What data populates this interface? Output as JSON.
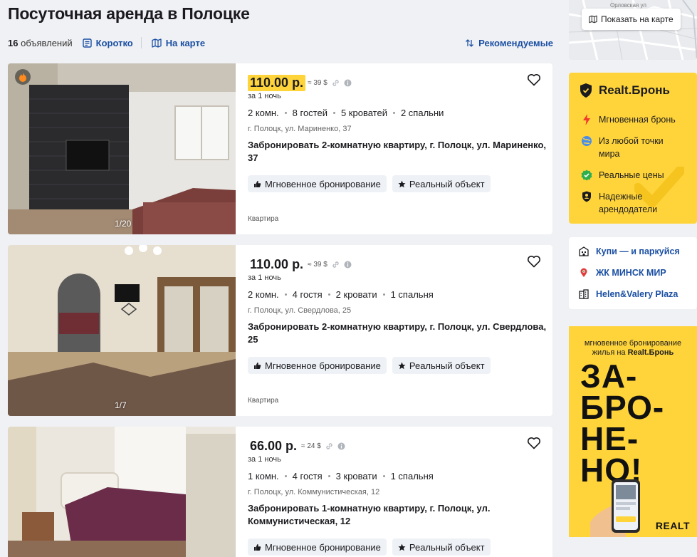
{
  "page": {
    "title": "Посуточная аренда в Полоцке"
  },
  "toolbar": {
    "count_number": "16",
    "count_label": "объявлений",
    "short_label": "Коротко",
    "map_label": "На карте",
    "sort_label": "Рекомендуемые"
  },
  "listings": [
    {
      "price": "110.00 р.",
      "usd": "≈ 39 $",
      "per": "за 1 ночь",
      "specs": [
        "2 комн.",
        "8 гостей",
        "5 кроватей",
        "2 спальни"
      ],
      "address": "г. Полоцк, ул. Мариненко, 37",
      "description": "Забронировать 2-комнатную квартиру, г. Полоцк, ул. Мариненко, 37",
      "badges": [
        "Мгновенное бронирование",
        "Реальный объект"
      ],
      "kind": "Квартира",
      "photo_counter": "1/20",
      "highlighted": true
    },
    {
      "price": "110.00 р.",
      "usd": "≈ 39 $",
      "per": "за 1 ночь",
      "specs": [
        "2 комн.",
        "4 гостя",
        "2 кровати",
        "1 спальня"
      ],
      "address": "г. Полоцк, ул. Свердлова, 25",
      "description": "Забронировать 2-комнатную квартиру, г. Полоцк, ул. Свердлова, 25",
      "badges": [
        "Мгновенное бронирование",
        "Реальный объект"
      ],
      "kind": "Квартира",
      "photo_counter": "1/7",
      "highlighted": false
    },
    {
      "price": "66.00 р.",
      "usd": "≈ 24 $",
      "per": "за 1 ночь",
      "specs": [
        "1 комн.",
        "4 гостя",
        "3 кровати",
        "1 спальня"
      ],
      "address": "г. Полоцк, ул. Коммунистическая, 12",
      "description": "Забронировать 1-комнатную квартиру, г. Полоцк, ул. Коммунистическая, 12",
      "badges": [
        "Мгновенное бронирование",
        "Реальный объект"
      ],
      "kind": "",
      "photo_counter": "",
      "highlighted": false
    }
  ],
  "sidebar": {
    "map_button": "Показать на карте",
    "map_labels": [
      "Орловская ул"
    ],
    "realt_title": "Realt.Бронь",
    "realt_items": [
      {
        "icon": "lightning-icon",
        "text": "Мгновенная бронь"
      },
      {
        "icon": "globe-icon",
        "text": "Из любой точки мира"
      },
      {
        "icon": "check-icon",
        "text": "Реальные цены"
      },
      {
        "icon": "shield-user-icon",
        "text": "Надежные арендодатели"
      }
    ],
    "links": [
      {
        "icon": "building-icon",
        "text": "Купи — и паркуйся"
      },
      {
        "icon": "pin-icon",
        "text": "ЖК МИНСК МИР"
      },
      {
        "icon": "tower-icon",
        "text": "Helen&Valery Plaza"
      }
    ],
    "ad": {
      "sub_line1": "мгновенное бронирование",
      "sub_line2_prefix": "жилья на ",
      "sub_line2_brand": "Realt.Бронь",
      "big_lines": [
        "ЗА-",
        "БРО-",
        "НЕ-",
        "НО!"
      ],
      "logo": "REALT"
    }
  },
  "colors": {
    "accent_blue": "#1a4fa3",
    "highlight_yellow": "#ffd43b",
    "page_bg": "#f0f1f4"
  }
}
